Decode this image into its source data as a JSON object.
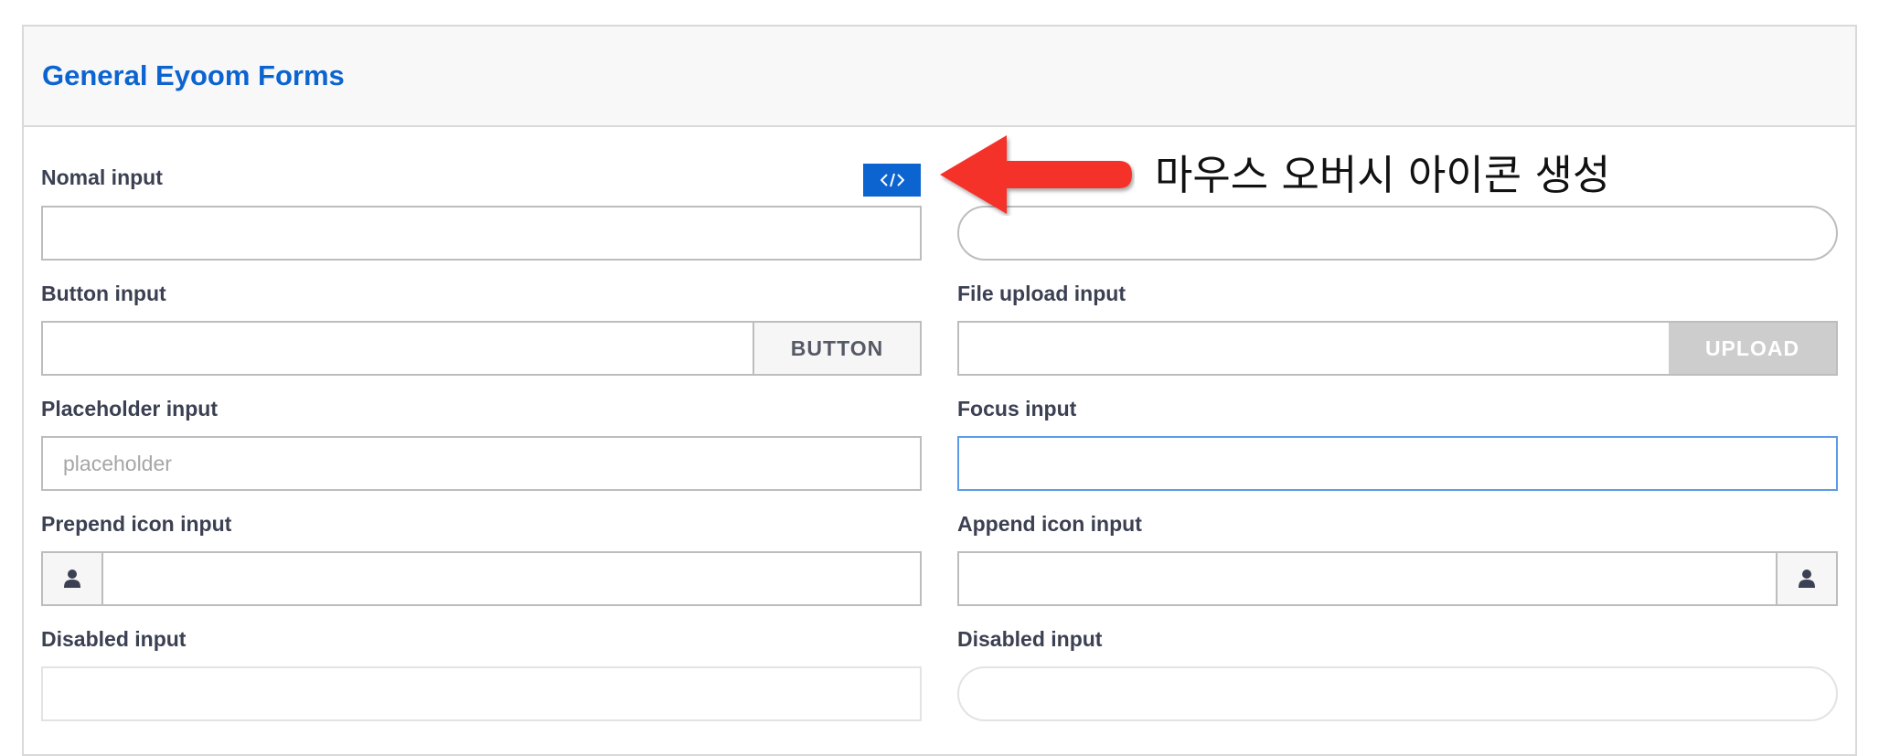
{
  "panel": {
    "title": "General Eyoom Forms"
  },
  "left": {
    "normal_label": "Nomal input",
    "button_label": "Button input",
    "button_text": "BUTTON",
    "placeholder_label": "Placeholder input",
    "placeholder_text": "placeholder",
    "prepend_label": "Prepend icon input",
    "disabled_label": "Disabled input"
  },
  "right": {
    "file_label": "File upload input",
    "upload_text": "UPLOAD",
    "focus_label": "Focus input",
    "append_label": "Append icon input",
    "disabled_label": "Disabled input"
  },
  "annotation": {
    "text": "마우스 오버시 아이콘 생성"
  },
  "icons": {
    "code": "code-icon",
    "user": "user-icon",
    "arrow": "red-arrow-icon"
  },
  "colors": {
    "accent": "#0c64d0",
    "label": "#3b4052",
    "border": "#bdbdbd",
    "focus_border": "#5b9be8",
    "upload_bg": "#cdcdcd",
    "arrow": "#f4322a"
  }
}
